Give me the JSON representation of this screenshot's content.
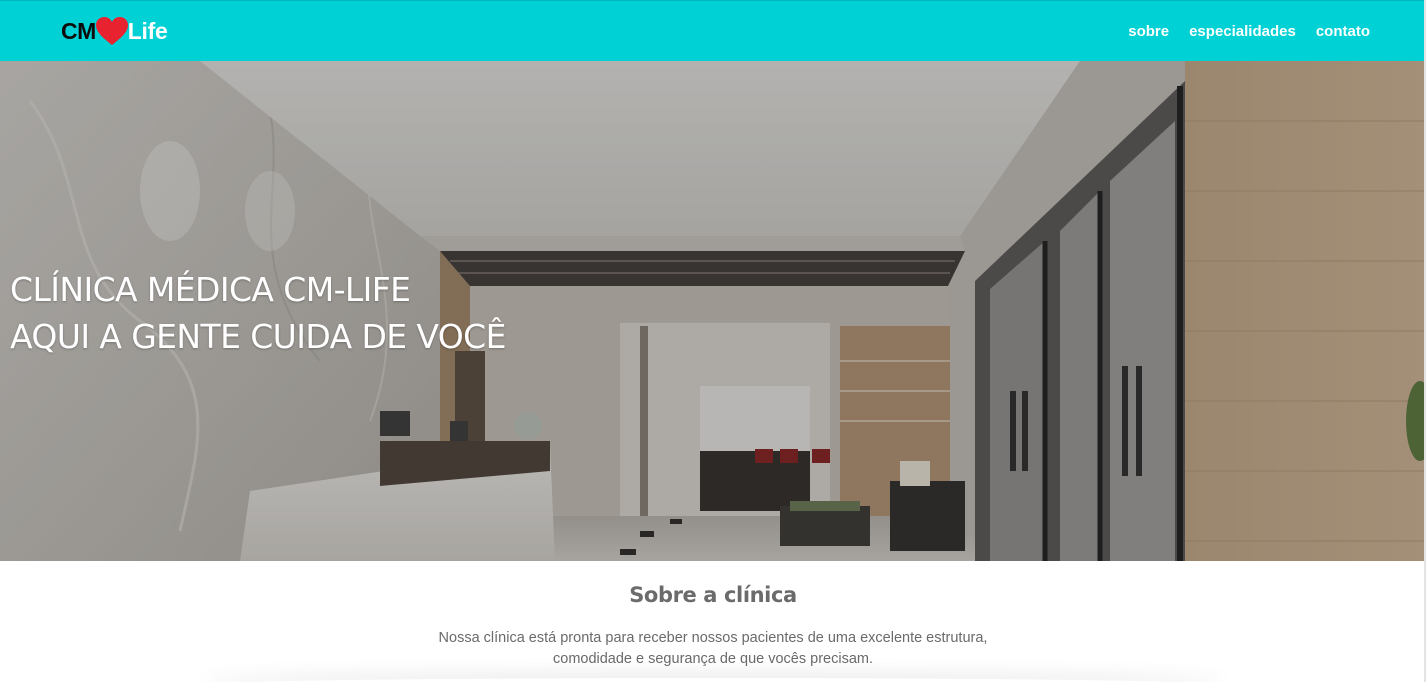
{
  "header": {
    "logo": {
      "part1": "CM",
      "part2": "Life",
      "heart_icon": "heart-icon",
      "heart_color": "#e8222e"
    },
    "background_color": "#00d1d4",
    "nav": [
      {
        "label": "sobre"
      },
      {
        "label": "especialidades"
      },
      {
        "label": "contato"
      }
    ]
  },
  "hero": {
    "title_line1": "CLÍNICA MÉDICA CM-LIFE",
    "title_line2": "AQUI A GENTE CUIDA DE VOCÊ",
    "image": "clinic-reception-lobby"
  },
  "about": {
    "heading": "Sobre a clínica",
    "text_line1": "Nossa clínica está pronta para receber nossos pacientes de uma excelente estrutura,",
    "text_line2": "comodidade e segurança de que vocês precisam."
  }
}
